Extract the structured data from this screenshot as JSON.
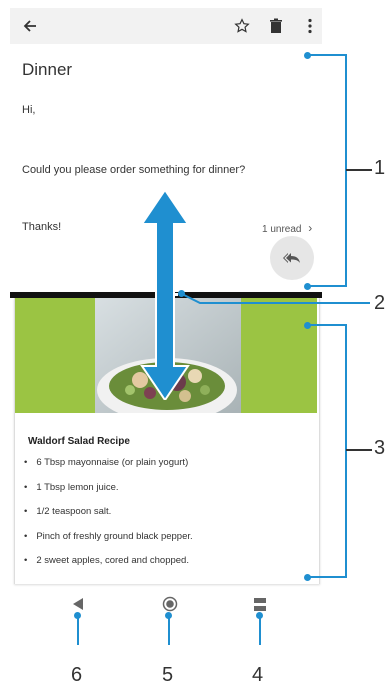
{
  "appbar": {
    "back_icon": "back-arrow-icon",
    "star_icon": "star-outline-icon",
    "delete_icon": "trash-icon",
    "menu_icon": "more-vert-icon"
  },
  "email": {
    "subject": "Dinner",
    "greeting": "Hi,",
    "body": "Could you please order something for dinner?",
    "signoff": "Thanks!",
    "unread": "1 unread",
    "reply_icon": "reply-all-icon"
  },
  "recipe": {
    "title": "Waldorf Salad Recipe",
    "ingredients": [
      "6 Tbsp mayonnaise (or plain yogurt)",
      "1 Tbsp lemon juice.",
      "1/2 teaspoon salt.",
      "Pinch of freshly ground black pepper.",
      "2 sweet apples, cored and chopped."
    ]
  },
  "callouts": [
    "1",
    "2",
    "3",
    "4",
    "5",
    "6"
  ],
  "colors": {
    "accent": "#1f8fd0",
    "green": "#9bc443",
    "divider": "#111111"
  }
}
